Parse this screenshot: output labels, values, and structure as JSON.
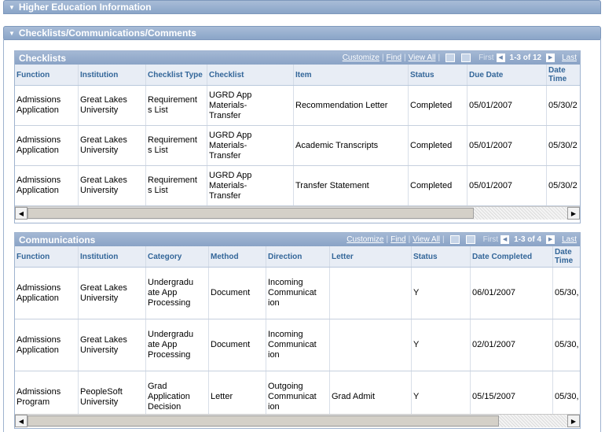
{
  "section_higher_ed": {
    "title": "Higher Education Information"
  },
  "section_checklists_comm": {
    "title": "Checklists/Communications/Comments"
  },
  "checklists": {
    "title": "Checklists",
    "nav": {
      "customize": "Customize",
      "find": "Find",
      "view_all": "View All",
      "first": "First",
      "count": "1-3 of 12",
      "last": "Last"
    },
    "columns": [
      "Function",
      "Institution",
      "Checklist Type",
      "Checklist",
      "Item",
      "Status",
      "Due Date",
      "Date Time"
    ],
    "rows": [
      [
        "Admissions\nApplication",
        "Great Lakes\nUniversity",
        "Requirement\ns List",
        "UGRD App\nMaterials-\nTransfer",
        "Recommendation Letter",
        "Completed",
        "05/01/2007",
        "05/30/2"
      ],
      [
        "Admissions\nApplication",
        "Great Lakes\nUniversity",
        "Requirement\ns List",
        "UGRD App\nMaterials-\nTransfer",
        "Academic Transcripts",
        "Completed",
        "05/01/2007",
        "05/30/2"
      ],
      [
        "Admissions\nApplication",
        "Great Lakes\nUniversity",
        "Requirement\ns List",
        "UGRD App\nMaterials-\nTransfer",
        "Transfer Statement",
        "Completed",
        "05/01/2007",
        "05/30/2"
      ]
    ]
  },
  "communications": {
    "title": "Communications",
    "nav": {
      "customize": "Customize",
      "find": "Find",
      "view_all": "View All",
      "first": "First",
      "count": "1-3 of 4",
      "last": "Last"
    },
    "columns": [
      "Function",
      "Institution",
      "Category",
      "Method",
      "Direction",
      "Letter",
      "Status",
      "Date Completed",
      "Date Time"
    ],
    "rows": [
      [
        "Admissions\nApplication",
        "Great Lakes\nUniversity",
        "Undergradu\nate App\nProcessing",
        "Document",
        "Incoming\nCommunicat\nion",
        "",
        "Y",
        "06/01/2007",
        "05/30,"
      ],
      [
        "Admissions\nApplication",
        "Great Lakes\nUniversity",
        "Undergradu\nate App\nProcessing",
        "Document",
        "Incoming\nCommunicat\nion",
        "",
        "Y",
        "02/01/2007",
        "05/30,"
      ],
      [
        "Admissions\nProgram",
        "PeopleSoft\nUniversity",
        "Grad\nApplication\nDecision",
        "Letter",
        "Outgoing\nCommunicat\nion",
        "Grad Admit",
        "Y",
        "05/15/2007",
        "05/30,"
      ]
    ]
  }
}
